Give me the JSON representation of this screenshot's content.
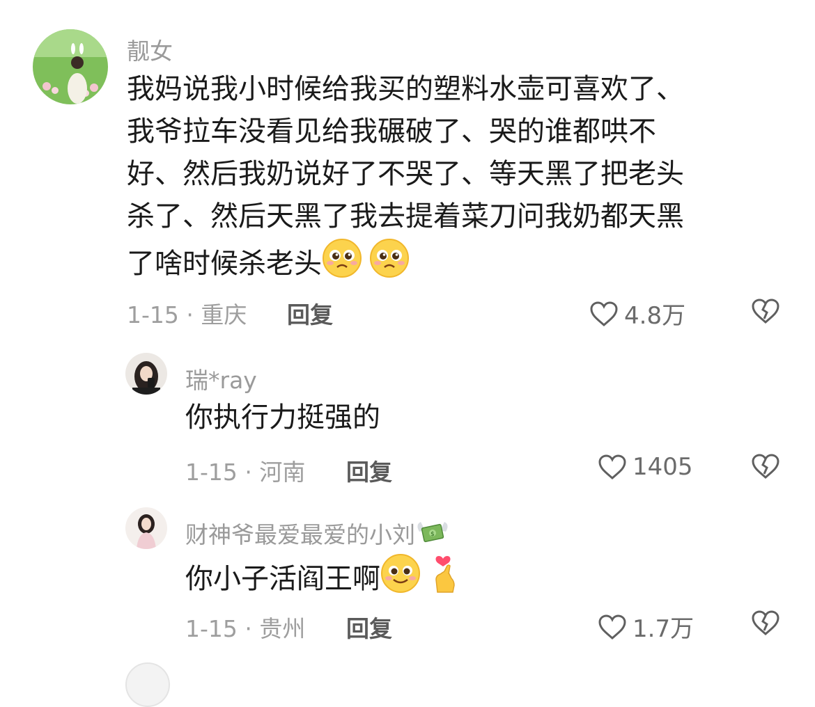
{
  "comments": [
    {
      "username": "靓女",
      "lines": [
        "我妈说我小时候给我买的塑料水壶可喜欢了、",
        "我爷拉车没看见给我碾破了、哭的谁都哄不",
        "好、然后我奶说好了不哭了、等天黑了把老头",
        "杀了、然后天黑了我去提着菜刀问我奶都天黑",
        "了啥时候杀老头"
      ],
      "emojis": [
        "pleading-face",
        "pleading-face"
      ],
      "meta": "1-15 · 重庆",
      "reply": "回复",
      "likes": "4.8万"
    },
    {
      "username": "瑞*ray",
      "lines": [
        "你执行力挺强的"
      ],
      "meta": "1-15 · 河南",
      "reply": "回复",
      "likes": "1405"
    },
    {
      "username": "财神爷最爱最爱的小刘",
      "username_emoji": "money-with-wings",
      "lines": [
        "你小子活阎王啊"
      ],
      "emojis": [
        "smiling-face",
        "finger-heart"
      ],
      "meta": "1-15 · 贵州",
      "reply": "回复",
      "likes": "1.7万"
    }
  ],
  "icons": {
    "like": "heart-outline-icon",
    "dislike": "broken-heart-icon"
  },
  "colors": {
    "username": "#9a9a9a",
    "text": "#1a1a1a",
    "meta": "#9e9e9e",
    "reply": "#5a5a5a"
  }
}
